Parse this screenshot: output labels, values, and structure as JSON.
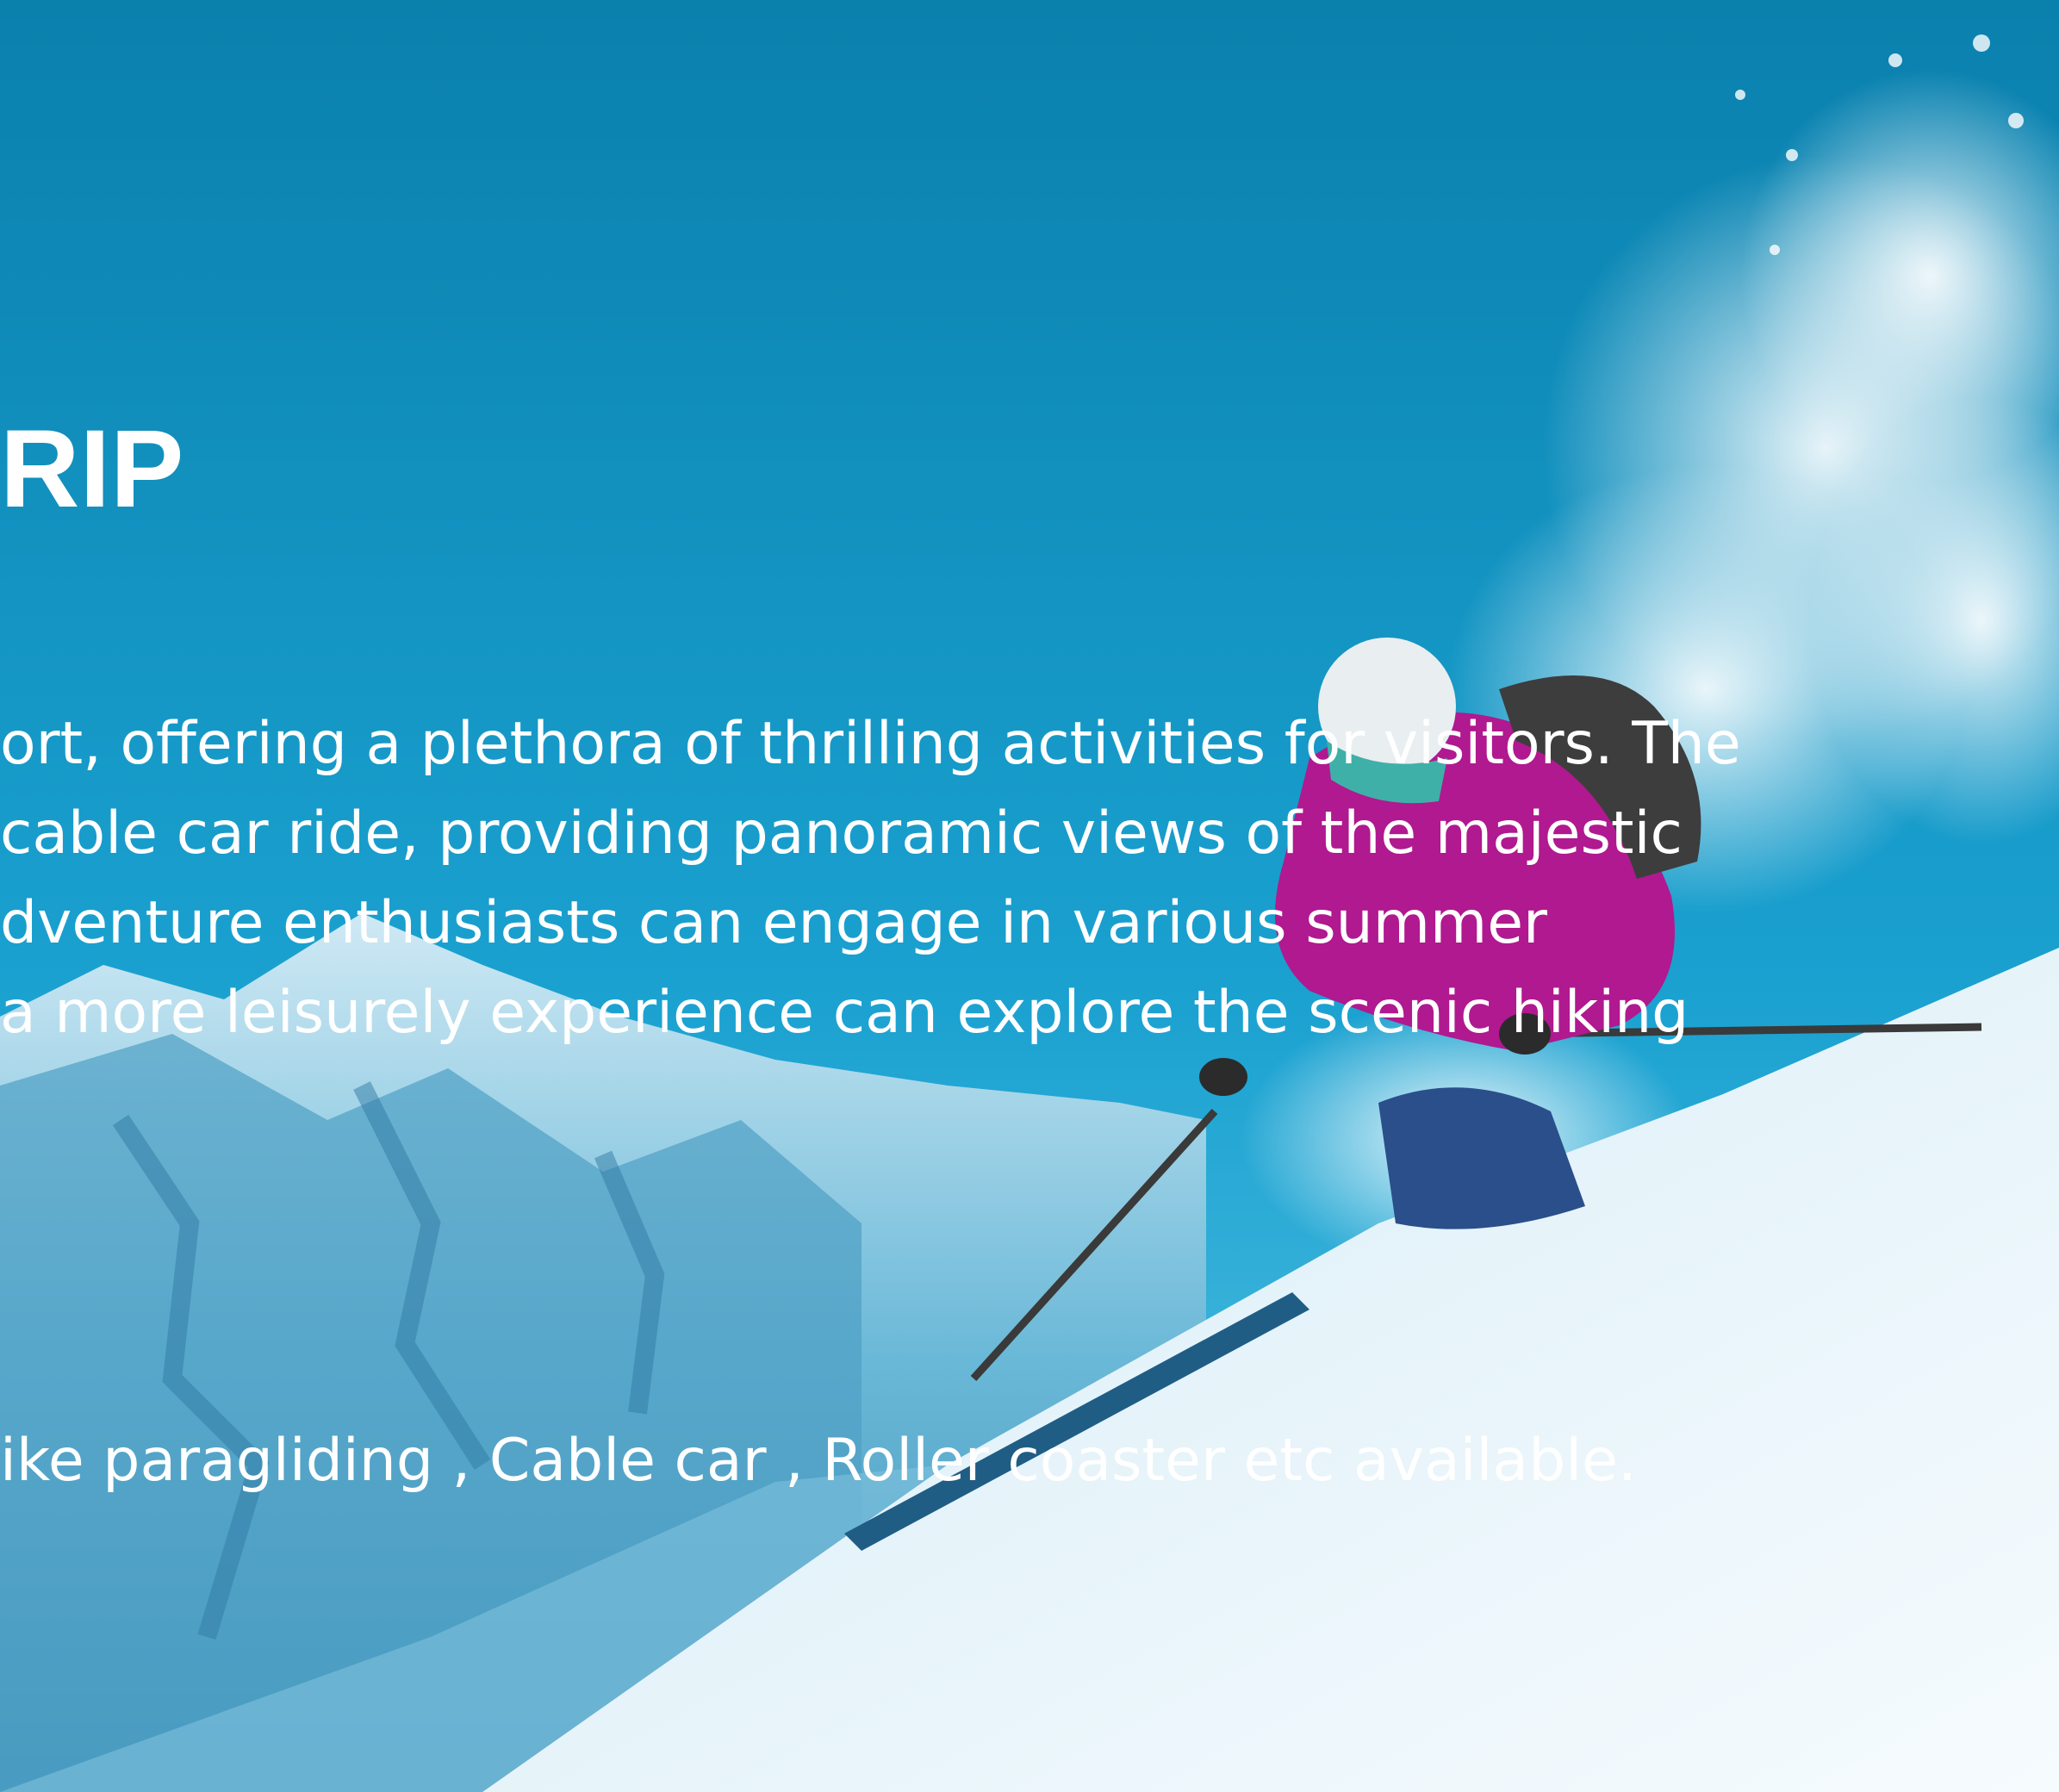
{
  "slide": {
    "title": "RIP",
    "paragraph_lines": [
      "ort, offering a plethora of thrilling activities for visitors. The",
      "cable car ride, providing panoramic views of the majestic",
      "dventure enthusiasts can engage in various summer",
      "a more leisurely experience can explore the scenic hiking"
    ],
    "note": "ike paragliding , Cable car , Roller coaster etc available."
  },
  "colors": {
    "sky": "#1497c6",
    "snow": "#eef6fb",
    "jacket": "#b0198f",
    "text": "#ffffff"
  }
}
